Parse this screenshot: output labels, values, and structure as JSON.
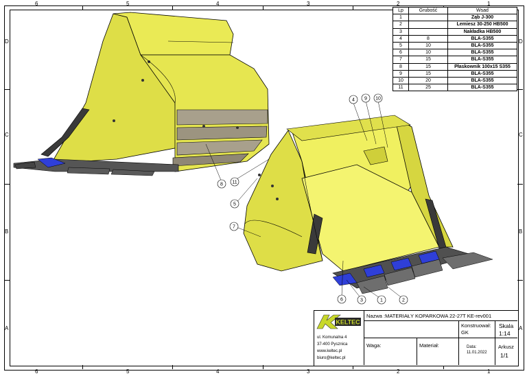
{
  "frame": {
    "columns_top": [
      "6",
      "5",
      "4",
      "3",
      "2",
      "1"
    ],
    "columns_bottom": [
      "6",
      "5",
      "4",
      "3",
      "2",
      "1"
    ],
    "rows_left": [
      "D",
      "C",
      "B",
      "A"
    ],
    "rows_right": [
      "D",
      "C",
      "B",
      "A"
    ]
  },
  "parts_list": {
    "headers": [
      "Lp",
      "Grubość",
      "Wsad"
    ],
    "rows": [
      {
        "lp": "1",
        "thickness": "",
        "material": "Ząb J-300"
      },
      {
        "lp": "2",
        "thickness": "",
        "material": "Lemiesz 30-250 HB500"
      },
      {
        "lp": "3",
        "thickness": "",
        "material": "Nakładka HB500"
      },
      {
        "lp": "4",
        "thickness": "8",
        "material": "BLA-S355"
      },
      {
        "lp": "5",
        "thickness": "10",
        "material": "BLA-S355"
      },
      {
        "lp": "6",
        "thickness": "10",
        "material": "BLA-S355"
      },
      {
        "lp": "7",
        "thickness": "15",
        "material": "BLA-S355"
      },
      {
        "lp": "8",
        "thickness": "15",
        "material": "Płaskownik 100x15 S355"
      },
      {
        "lp": "9",
        "thickness": "15",
        "material": "BLA-S355"
      },
      {
        "lp": "10",
        "thickness": "20",
        "material": "BLA-S355"
      },
      {
        "lp": "11",
        "thickness": "25",
        "material": "BLA-S355"
      }
    ]
  },
  "balloons": [
    "4",
    "9",
    "10",
    "8",
    "11",
    "5",
    "7",
    "6",
    "3",
    "1",
    "2"
  ],
  "title_block": {
    "logo_text": "KELTEC",
    "address": [
      "ul. Komunalna 4",
      "37-400 Pysznica",
      "www.keltec.pl",
      "biuro@keltec.pl"
    ],
    "name": "Nazwa :MATERIAŁY KOPARKOWA 22-27T KE-rev001",
    "designed_label": "Konstruował:",
    "designed_value": "GK",
    "scale_label": "Skala",
    "scale_value": "1:14",
    "weight_label": "Waga:",
    "material_label": "Materiał:",
    "date_label": "Data:",
    "date_value": "11.01.2022",
    "sheet_label": "Arkusz",
    "sheet_value": "1/1"
  },
  "colors": {
    "body_yellow": "#e6e650",
    "body_shadow": "#bcbc2e",
    "liner_gray": "#a8a08c",
    "wear_dark": "#4a4a4a",
    "tooth_gray": "#6e6e6e",
    "adapter_blue": "#2f3fd8"
  }
}
